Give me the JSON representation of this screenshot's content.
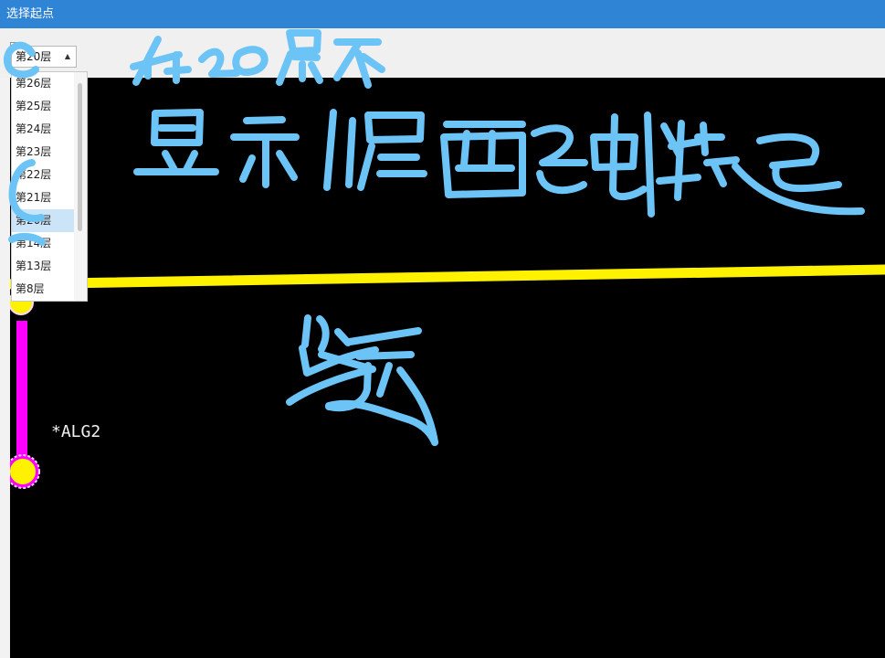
{
  "window": {
    "title": "选择起点"
  },
  "layer_selector": {
    "current_value": "第20层",
    "options": [
      "第26层",
      "第25层",
      "第24层",
      "第23层",
      "第22层",
      "第21层",
      "第20层",
      "第14层",
      "第13层",
      "第8层"
    ],
    "selected_option": "第20层"
  },
  "canvas": {
    "net_label": "*ALG2",
    "colors": {
      "background": "#000000",
      "trace": "#fff200",
      "via_fill": "#fff200",
      "via_outline": "#ff00ff",
      "vertical_trace": "#ff00ff"
    }
  },
  "annotation": {
    "color": "#6cc4f6",
    "handwriting": "在20层不显示17层西面的起"
  }
}
